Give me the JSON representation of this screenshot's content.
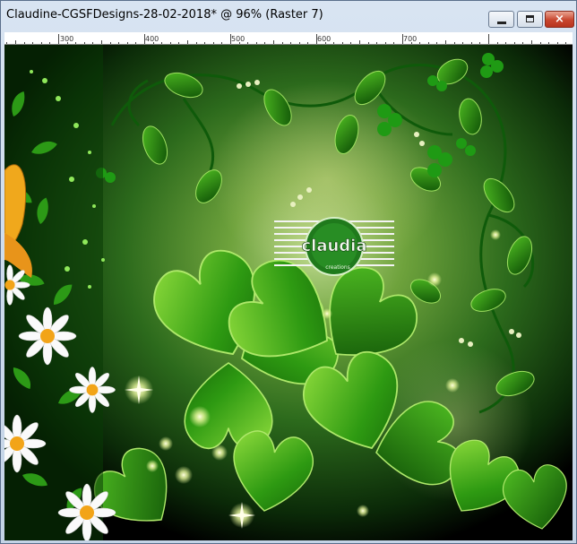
{
  "window": {
    "title": "Claudine-CGSFDesigns-28-02-2018* @  96% (Raster 7)",
    "buttons": {
      "minimize": "minimize",
      "maximize": "maximize",
      "close": "×"
    }
  },
  "ruler": {
    "ticks": [
      "300",
      "400",
      "500",
      "600",
      "700"
    ]
  },
  "watermark": {
    "name": "claudia",
    "subtitle": "creations"
  },
  "colors": {
    "clover_green": "#2f9e14",
    "clover_light": "#7fd23a",
    "background": "#000000",
    "close_button": "#c8462e"
  }
}
